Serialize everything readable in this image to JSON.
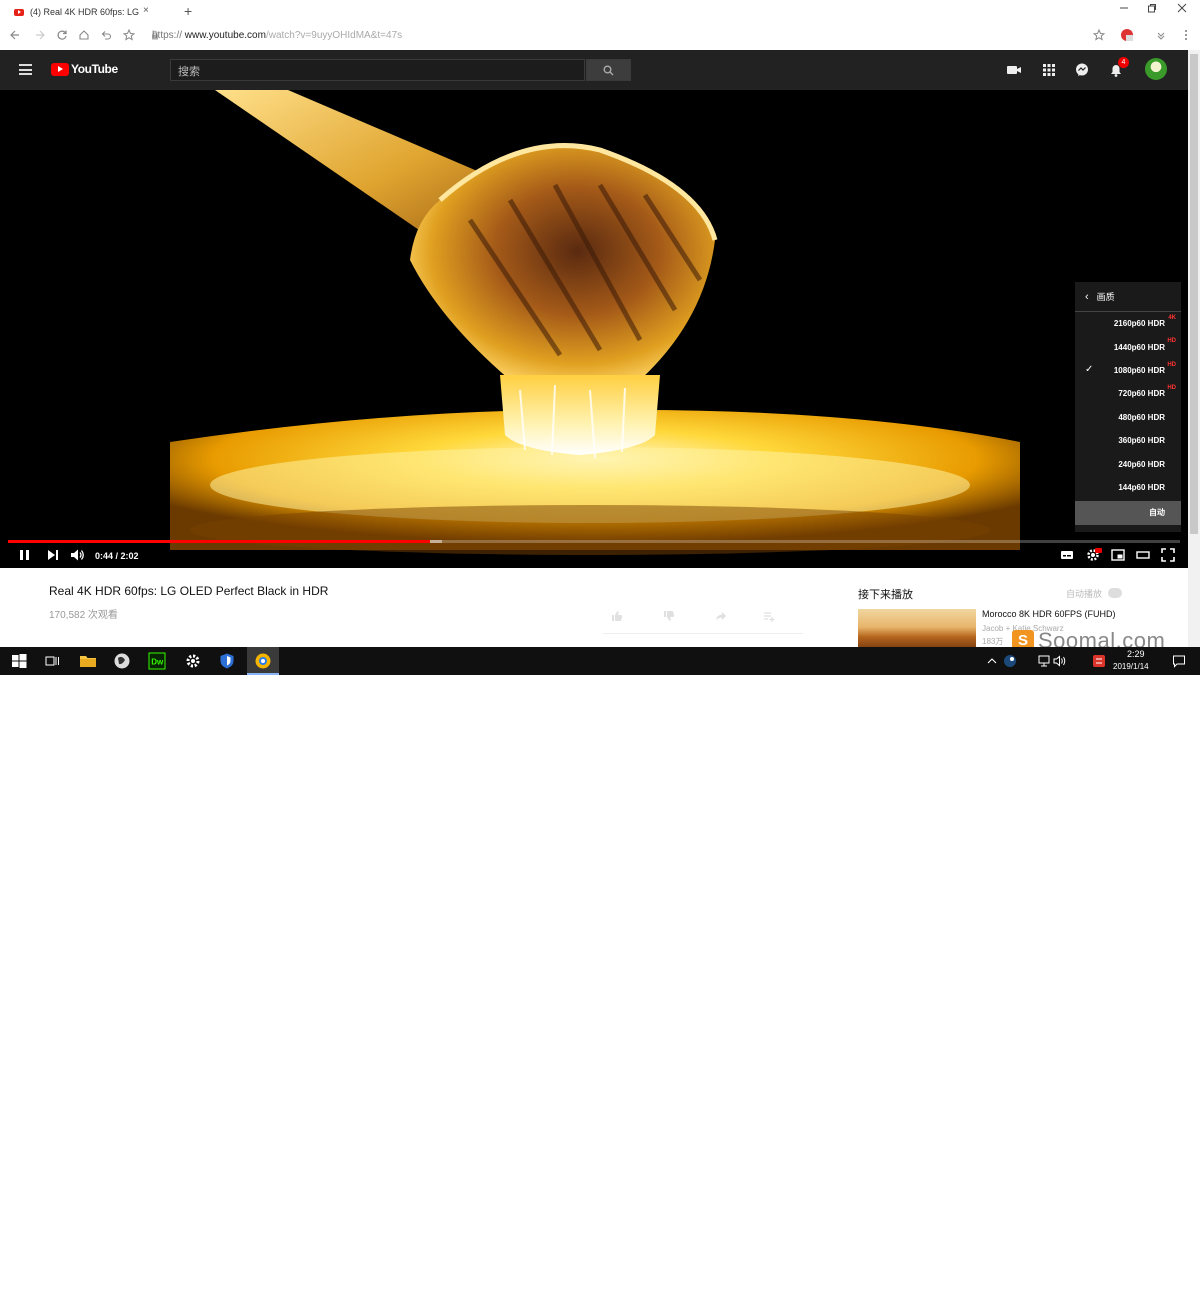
{
  "browser": {
    "tab_title": "(4) Real 4K HDR 60fps: LG",
    "tab_close": "×",
    "new_tab": "+",
    "url_scheme": "https://",
    "url_host": "www.youtube.com",
    "url_path": "/watch?v=9uyyOHIdMA&t=47s"
  },
  "youtube": {
    "logo_text": "YouTube",
    "search_placeholder": "搜索",
    "notification_count": "4"
  },
  "player": {
    "current_time": "0:44",
    "duration": "2:02",
    "time_display": "0:44 / 2:02",
    "played_fraction": 0.36,
    "buffered_fraction": 0.37
  },
  "quality_menu": {
    "header": "画质",
    "items": [
      {
        "label": "2160p60 HDR",
        "badge": "4K",
        "selected": false
      },
      {
        "label": "1440p60 HDR",
        "badge": "HD",
        "selected": false
      },
      {
        "label": "1080p60 HDR",
        "badge": "HD",
        "selected": true
      },
      {
        "label": "720p60 HDR",
        "badge": "HD",
        "selected": false
      },
      {
        "label": "480p60 HDR",
        "badge": "",
        "selected": false
      },
      {
        "label": "360p60 HDR",
        "badge": "",
        "selected": false
      },
      {
        "label": "240p60 HDR",
        "badge": "",
        "selected": false
      },
      {
        "label": "144p60 HDR",
        "badge": "",
        "selected": false
      }
    ],
    "auto_label": "自动"
  },
  "video_info": {
    "title": "Real 4K HDR 60fps: LG OLED Perfect Black in HDR",
    "views": "170,582 次观看"
  },
  "sidebar": {
    "up_next": "接下来播放",
    "autoplay": "自动播放",
    "recommendation": {
      "title": "Morocco 8K HDR 60FPS (FUHD)",
      "channel": "Jacob + Katie Schwarz",
      "views": "183万"
    }
  },
  "watermark": {
    "logo_letter": "S",
    "text": "Soomal.com"
  },
  "taskbar": {
    "ime": "中",
    "time": "2:29",
    "date": "2019/1/14",
    "dw_label": "Dw"
  },
  "colors": {
    "yt_red": "#ff0000",
    "header_bg": "#222222",
    "badge_red": "#ff3333",
    "taskbar_bg": "#101010"
  }
}
